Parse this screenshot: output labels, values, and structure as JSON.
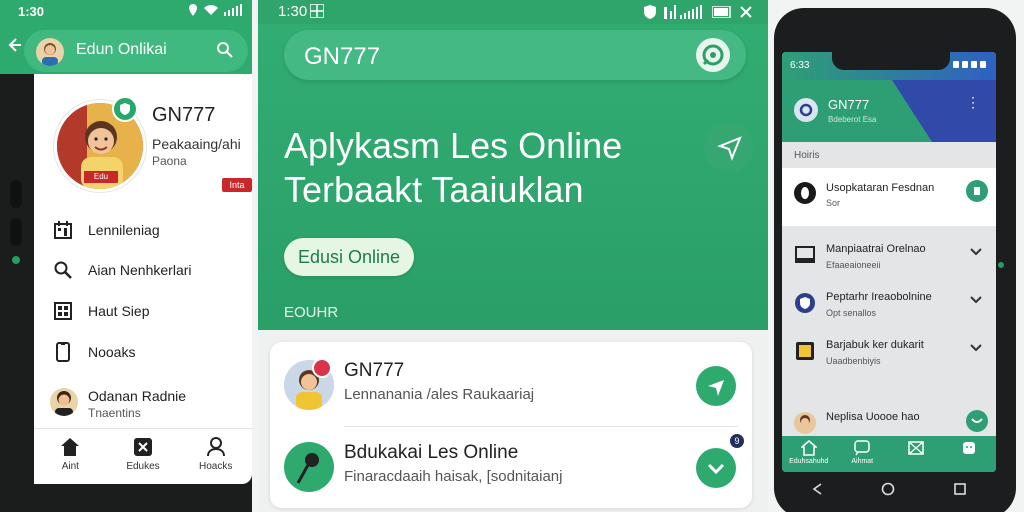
{
  "left_phone": {
    "status_time": "1:30",
    "app_title": "Edun Onlikai",
    "user": {
      "name": "GN777",
      "subtitle": "Peakaaing/ahi",
      "role": "Paona",
      "tag": "Inta"
    },
    "avatar_badge": "Edu",
    "menu": [
      {
        "label": "Lennileniag",
        "icon": "calendar-icon"
      },
      {
        "label": "Aian Nenhkerlari",
        "icon": "search-icon"
      },
      {
        "label": "Haut Siep",
        "icon": "apps-icon"
      },
      {
        "label": "Nooaks",
        "icon": "phone-icon"
      }
    ],
    "profile": {
      "name": "Odanan Radnie",
      "subtitle": "Tnaentins"
    },
    "bottom_nav": [
      {
        "label": "Aint",
        "icon": "home-icon"
      },
      {
        "label": "Edukes",
        "icon": "x-box-icon"
      },
      {
        "label": "Hoacks",
        "icon": "person-icon"
      }
    ],
    "colors": {
      "primary": "#2faa6e",
      "accent_red": "#c9282b"
    }
  },
  "main": {
    "status_time": "1:30",
    "search_text": "GN777",
    "headline_line1": "Aplykasm Les Online",
    "headline_line2": "Terbaakt Taaiuklan",
    "cta_label": "Edusi Online",
    "section_label": "EOUHR",
    "rows": [
      {
        "title": "GN777",
        "subtitle": "Lennanania /ales Raukaariaj"
      },
      {
        "title": "Bdukakai Les Online",
        "subtitle": "Finaracdaaih haisak, [sodnitaianj"
      }
    ],
    "badge_count": "9",
    "colors": {
      "primary": "#2faa6e",
      "card": "#ffffff"
    }
  },
  "right_phone": {
    "status_time": "6:33",
    "header_title": "GN777",
    "header_subtitle": "Bdeberot Esa",
    "section_label": "Hoiris",
    "featured": {
      "title": "Usopkataran Fesdnan",
      "subtitle": "Sor"
    },
    "items": [
      {
        "title": "Manpiaatrai Orelnao",
        "subtitle": "Efaaeaioneeii",
        "icon": "book-icon"
      },
      {
        "title": "Peptarhr Ireaobolnine",
        "subtitle": "Opt senallos",
        "icon": "shield-icon"
      },
      {
        "title": "Barjabuk ker dukarit",
        "subtitle": "Uaadbenbiyis",
        "icon": "tablet-icon"
      },
      {
        "title": "Neplisa Uoooe hao",
        "subtitle": "",
        "icon": "avatar"
      }
    ],
    "bottom_nav": [
      {
        "label": "Eduhsahuhd",
        "icon": "home-icon"
      },
      {
        "label": "Aihmat",
        "icon": "chat-icon"
      },
      {
        "label": "",
        "icon": "mail-icon"
      },
      {
        "label": "",
        "icon": "smile-icon"
      }
    ],
    "colors": {
      "green": "#2e9f75",
      "blue": "#2f60c2"
    }
  }
}
